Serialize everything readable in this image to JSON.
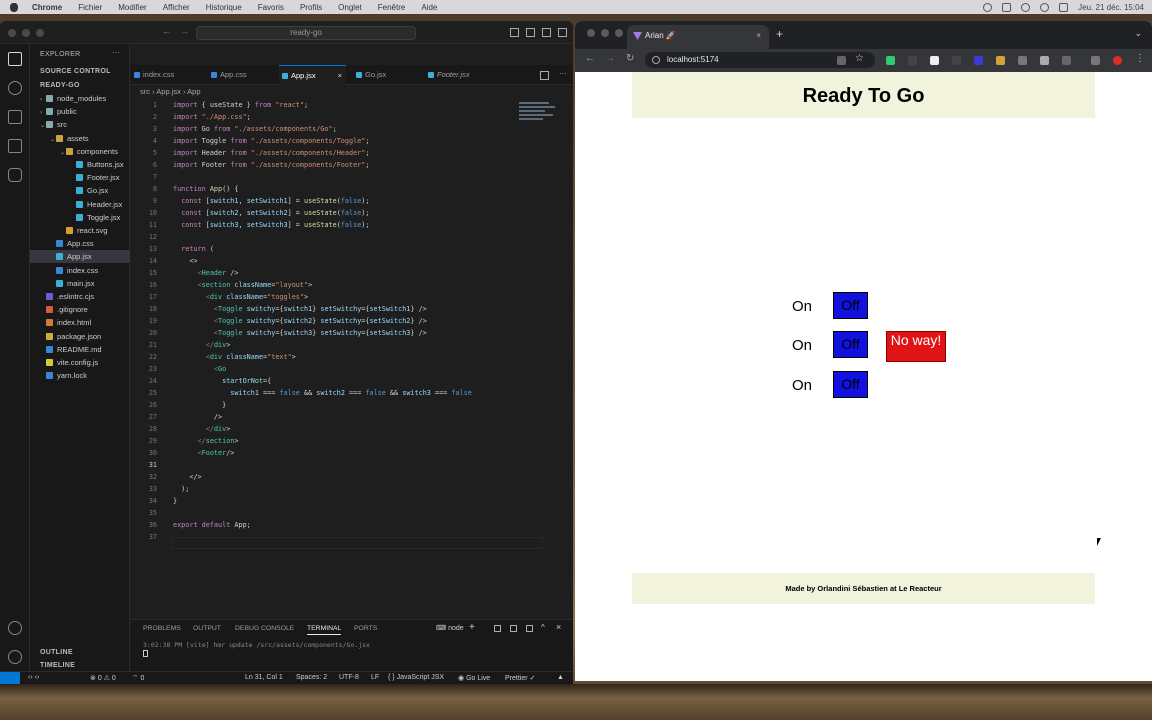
{
  "menubar": {
    "app": "Chrome",
    "items": [
      "Fichier",
      "Modifier",
      "Afficher",
      "Historique",
      "Favoris",
      "Profils",
      "Onglet",
      "Fenêtre",
      "Aide"
    ],
    "clock": "Jeu. 21 déc.  15:04"
  },
  "vscode": {
    "search": "ready-go",
    "sidebar": {
      "header": "EXPLORER",
      "source_control": "SOURCE CONTROL",
      "project": "READY-GO",
      "outline": "OUTLINE",
      "timeline": "TIMELINE",
      "tree": [
        {
          "label": "node_modules",
          "kind": "folder",
          "color": "#8aa"
        },
        {
          "label": "public",
          "kind": "folder",
          "color": "#8aa"
        },
        {
          "label": "src",
          "kind": "folder-open",
          "color": "#8aa"
        },
        {
          "label": "assets",
          "kind": "folder-open",
          "color": "#c9a33e"
        },
        {
          "label": "components",
          "kind": "folder-open",
          "color": "#c9a33e"
        },
        {
          "label": "Buttons.jsx",
          "kind": "file",
          "color": "#3ab0d6"
        },
        {
          "label": "Footer.jsx",
          "kind": "file",
          "color": "#3ab0d6"
        },
        {
          "label": "Go.jsx",
          "kind": "file",
          "color": "#3ab0d6"
        },
        {
          "label": "Header.jsx",
          "kind": "file",
          "color": "#3ab0d6"
        },
        {
          "label": "Toggle.jsx",
          "kind": "file",
          "color": "#3ab0d6"
        },
        {
          "label": "react.svg",
          "kind": "file",
          "color": "#d9a030"
        },
        {
          "label": "App.css",
          "kind": "file",
          "color": "#3a86d6"
        },
        {
          "label": "App.jsx",
          "kind": "file",
          "color": "#3ab0d6"
        },
        {
          "label": "index.css",
          "kind": "file",
          "color": "#3a86d6"
        },
        {
          "label": "main.jsx",
          "kind": "file",
          "color": "#3ab0d6"
        },
        {
          "label": ".eslintrc.cjs",
          "kind": "file",
          "color": "#6e5bd6"
        },
        {
          "label": ".gitignore",
          "kind": "file",
          "color": "#d65b3a"
        },
        {
          "label": "index.html",
          "kind": "file",
          "color": "#d67a3a"
        },
        {
          "label": "package.json",
          "kind": "file",
          "color": "#c9b03e"
        },
        {
          "label": "README.md",
          "kind": "file",
          "color": "#3a86d6"
        },
        {
          "label": "vite.config.js",
          "kind": "file",
          "color": "#d6c93a"
        },
        {
          "label": "yarn.lock",
          "kind": "file",
          "color": "#3a86d6"
        }
      ]
    },
    "tabs": [
      "index.css",
      "App.css",
      "App.jsx",
      "Go.jsx",
      "Footer.jsx"
    ],
    "active_tab": "App.jsx",
    "breadcrumb": [
      "src",
      "App.jsx",
      "App"
    ],
    "code_lines": [
      "import { useState } from \"react\";",
      "import \"./App.css\";",
      "import Go from \"./assets/components/Go\";",
      "import Toggle from \"./assets/components/Toggle\";",
      "import Header from \"./assets/components/Header\";",
      "import Footer from \"./assets/components/Footer\";",
      "",
      "function App() {",
      "  const [switch1, setSwitch1] = useState(false);",
      "  const [switch2, setSwitch2] = useState(false);",
      "  const [switch3, setSwitch3] = useState(false);",
      "",
      "  return (",
      "    <>",
      "      <Header />",
      "      <section className=\"layout\">",
      "        <div className=\"toggles\">",
      "          <Toggle switchy={switch1} setSwitchy={setSwitch1} />",
      "          <Toggle switchy={switch2} setSwitchy={setSwitch2} />",
      "          <Toggle switchy={switch3} setSwitchy={setSwitch3} />",
      "        </div>",
      "        <div className=\"text\">",
      "          <Go",
      "            startOrNot={",
      "              switch1 === false && switch2 === false && switch3 === false",
      "            }",
      "          />",
      "        </div>",
      "      </section>",
      "      <Footer/>",
      "",
      "    </>",
      "  );",
      "}",
      "",
      "export default App;",
      ""
    ],
    "current_line": 31,
    "panel": {
      "tabs": [
        "PROBLEMS",
        "OUTPUT",
        "DEBUG CONSOLE",
        "TERMINAL",
        "PORTS"
      ],
      "active": "TERMINAL",
      "shell": "node",
      "terminal_line": "3:02:38 PM [vite] hmr update /src/assets/components/Go.jsx"
    },
    "status": {
      "errors": "0",
      "warnings": "0",
      "ports": "0",
      "position": "Ln 31, Col 1",
      "spaces": "Spaces: 2",
      "encoding": "UTF-8",
      "eol": "LF",
      "language": "JavaScript JSX",
      "golive": "Go Live",
      "prettier": "Prettier"
    }
  },
  "chrome": {
    "tab_title": "Arian 🚀",
    "url": "localhost:5174",
    "page": {
      "header": "Ready To Go",
      "toggles": [
        {
          "on_label": "On",
          "off_label": "Off"
        },
        {
          "on_label": "On",
          "off_label": "Off"
        },
        {
          "on_label": "On",
          "off_label": "Off"
        }
      ],
      "message": "No way!",
      "footer": "Made by Orlandini Sébastien at Le Reacteur"
    }
  },
  "colors": {
    "header_bg": "#f1f3dc",
    "off_button": "#1212e0",
    "noway_button": "#e01414",
    "vscode_accent": "#0078d4"
  }
}
